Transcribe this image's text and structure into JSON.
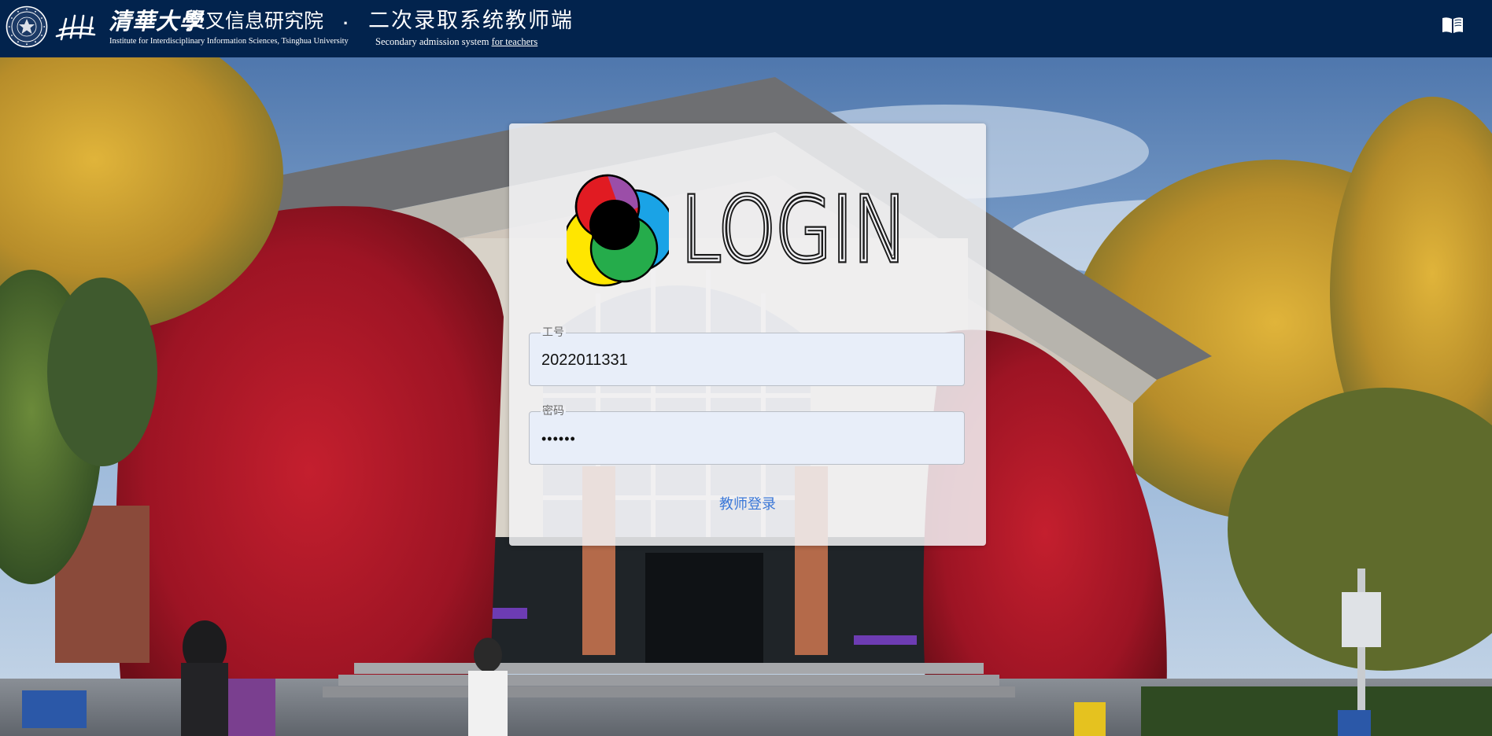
{
  "header": {
    "university_cn": "清華大學",
    "institute_cn": "交叉信息研究院",
    "institute_en": "Institute for Interdisciplinary Information Sciences, Tsinghua University",
    "separator": "·",
    "system_cn": "二次录取系统教师端",
    "system_en_prefix": "Secondary admission system ",
    "system_en_suffix": "for teachers",
    "manual_icon": "book-open-icon",
    "background_color": "#02234d"
  },
  "login": {
    "logo_word": "LOGIN",
    "id_field": {
      "label": "工号",
      "value": "2022011331"
    },
    "password_field": {
      "label": "密码",
      "value": "••••••"
    },
    "submit_label": "教师登录",
    "accent_color": "#3b78d8"
  }
}
